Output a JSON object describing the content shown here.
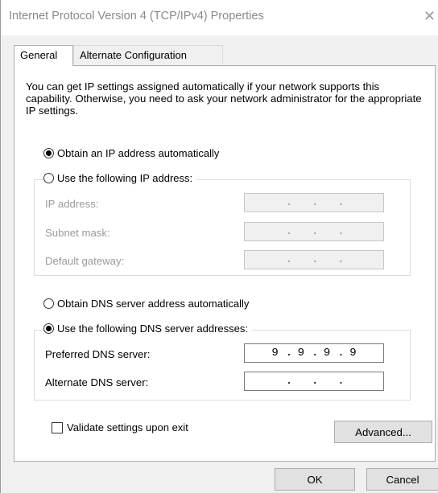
{
  "window": {
    "title": "Internet Protocol Version 4 (TCP/IPv4) Properties",
    "close_glyph": "✕"
  },
  "tabs": [
    {
      "label": "General",
      "active": true
    },
    {
      "label": "Alternate Configuration",
      "active": false
    }
  ],
  "intro_text": "You can get IP settings assigned automatically if your network supports this capability. Otherwise, you need to ask your network administrator for the appropriate IP settings.",
  "ip": {
    "auto_label": "Obtain an IP address automatically",
    "manual_label": "Use the following IP address:",
    "selected": "auto",
    "fields": [
      {
        "label": "IP address:",
        "value": [
          "",
          "",
          "",
          ""
        ]
      },
      {
        "label": "Subnet mask:",
        "value": [
          "",
          "",
          "",
          ""
        ]
      },
      {
        "label": "Default gateway:",
        "value": [
          "",
          "",
          "",
          ""
        ]
      }
    ]
  },
  "dns": {
    "auto_label": "Obtain DNS server address automatically",
    "manual_label": "Use the following DNS server addresses:",
    "selected": "manual",
    "preferred_label": "Preferred DNS server:",
    "preferred_value": [
      "9",
      "9",
      "9",
      "9"
    ],
    "alternate_label": "Alternate DNS server:",
    "alternate_value": [
      "",
      "",
      "",
      ""
    ]
  },
  "validate": {
    "label": "Validate settings upon exit",
    "checked": false
  },
  "buttons": {
    "advanced": "Advanced...",
    "ok": "OK",
    "cancel": "Cancel"
  }
}
